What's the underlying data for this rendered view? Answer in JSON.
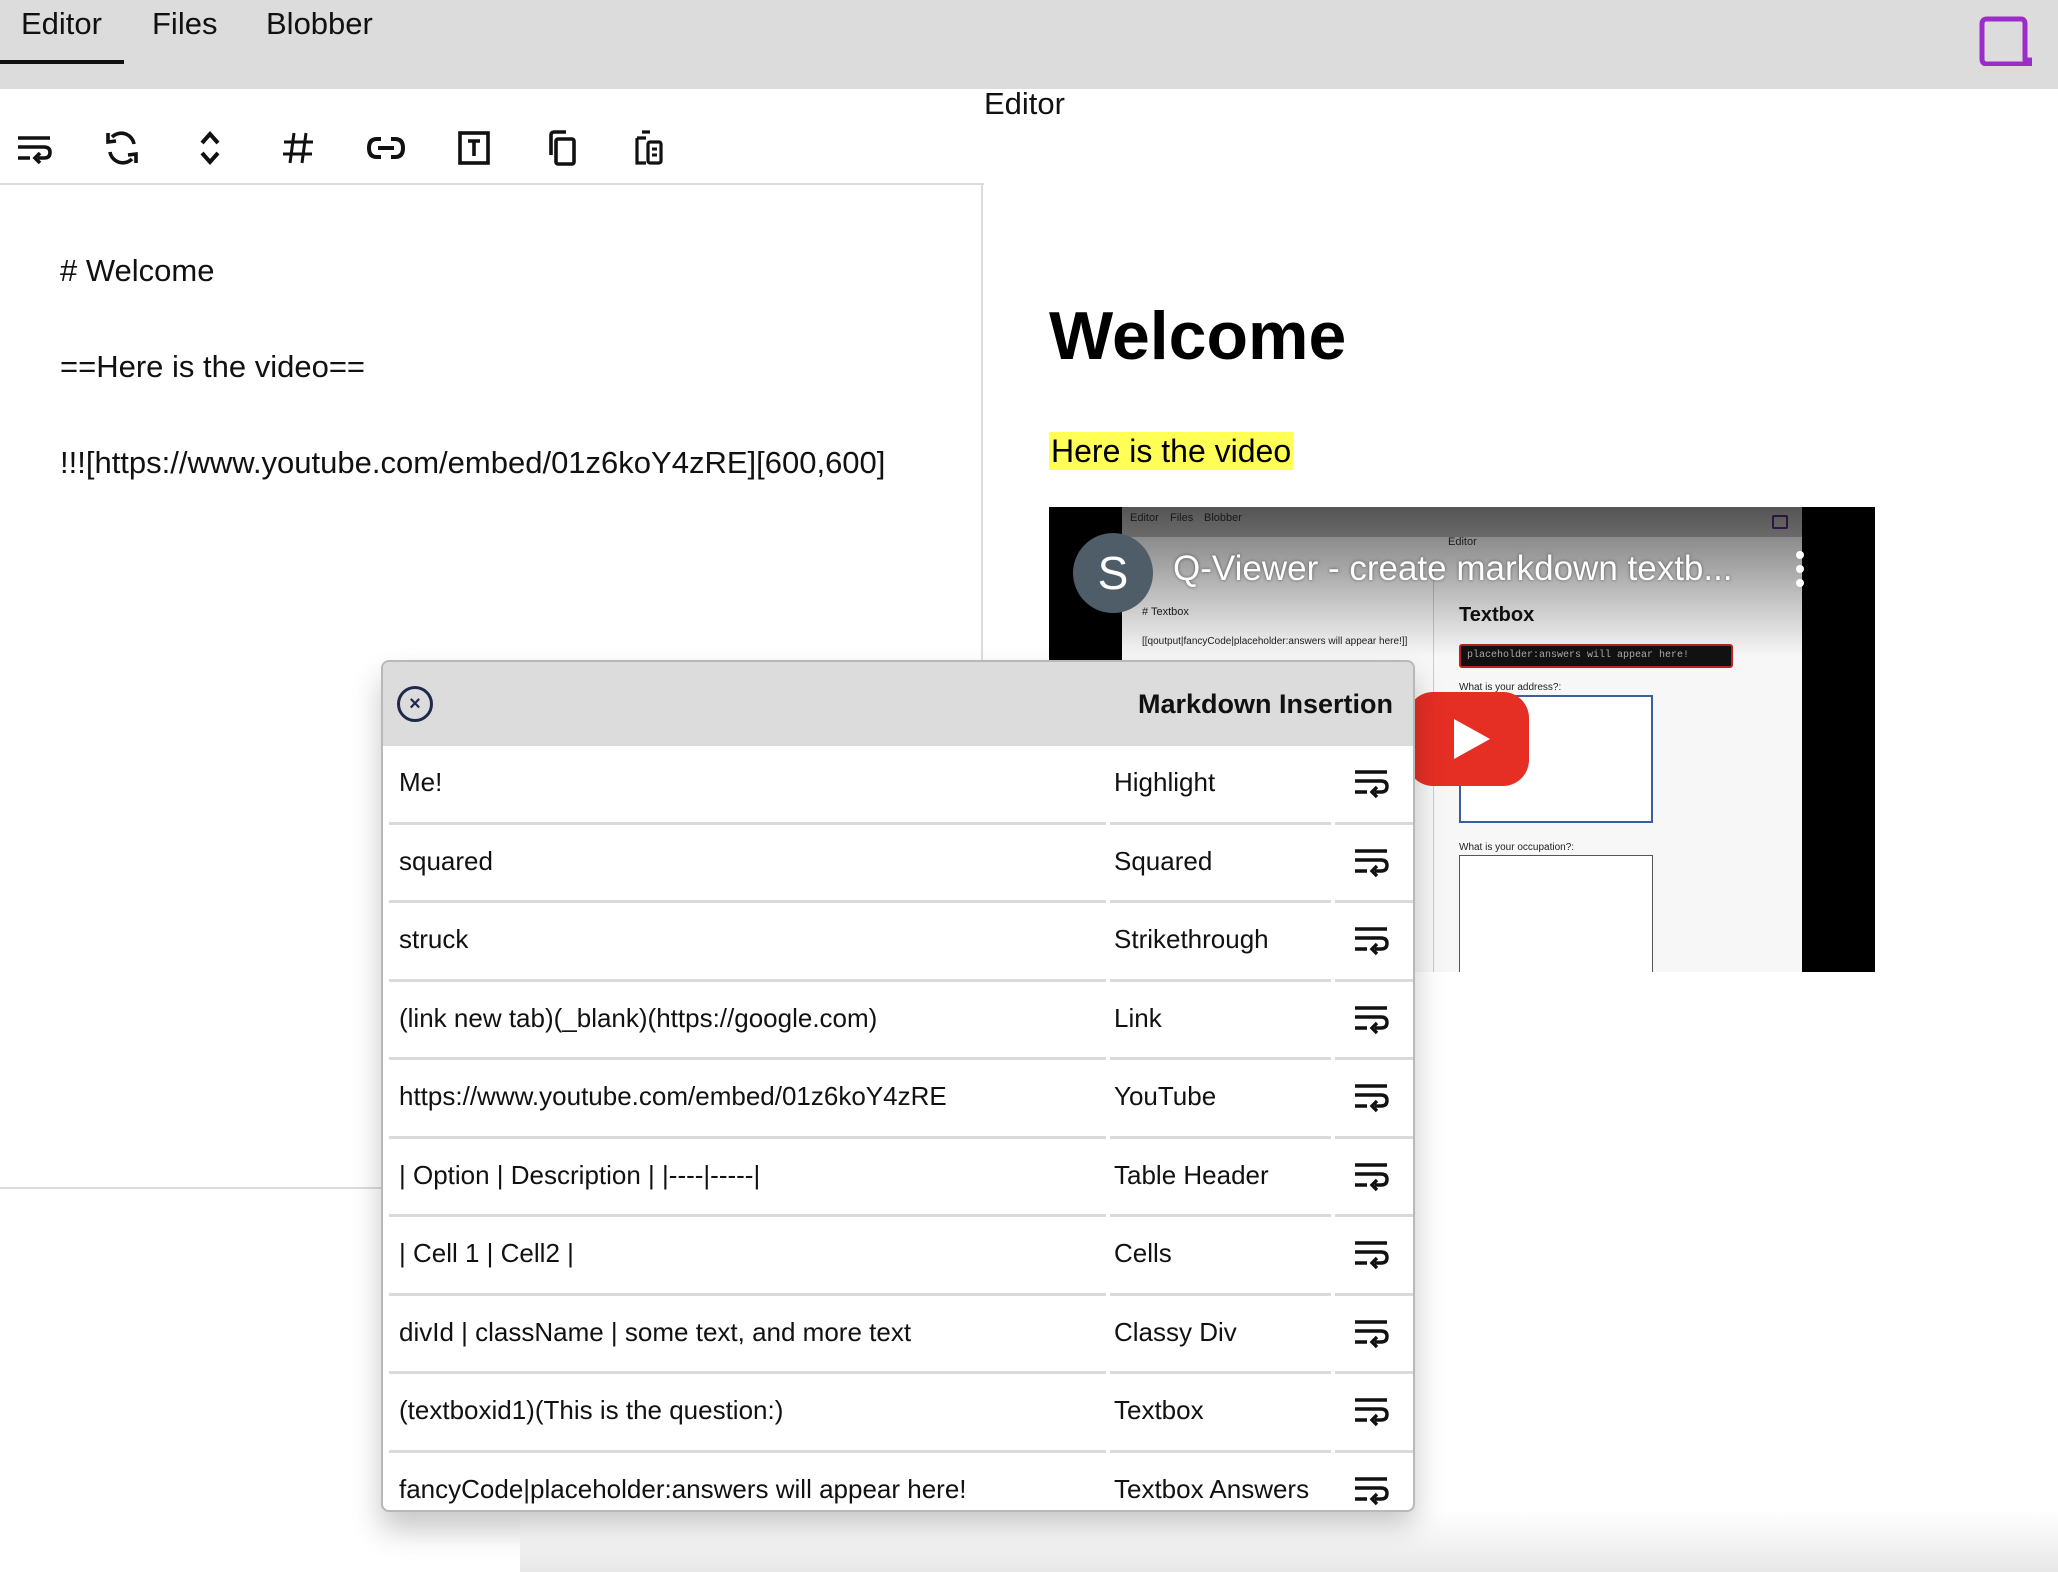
{
  "nav": {
    "tabs": [
      {
        "label": "Editor",
        "active": true
      },
      {
        "label": "Files",
        "active": false
      },
      {
        "label": "Blobber",
        "active": false
      }
    ],
    "logo_color": "#9b2cc8"
  },
  "page_title": "Editor",
  "toolbar": {
    "buttons": [
      {
        "icon": "wrap-text-icon"
      },
      {
        "icon": "refresh-icon"
      },
      {
        "icon": "expand-collapse-icon"
      },
      {
        "icon": "hash-icon"
      },
      {
        "icon": "link-icon"
      },
      {
        "icon": "text-box-icon"
      },
      {
        "icon": "copy-icon"
      },
      {
        "icon": "paste-icon"
      }
    ]
  },
  "editor": {
    "lines": [
      "# Welcome",
      "==Here is the video==",
      "!!![https://www.youtube.com/embed/01z6koY4zRE][600,600]"
    ]
  },
  "preview": {
    "heading": "Welcome",
    "highlight": "Here is the video",
    "highlight_color": "#ffff55",
    "video": {
      "channel_initial": "S",
      "title": "Q-Viewer - create markdown textb...",
      "inner": {
        "tabs": [
          "Editor",
          "Files",
          "Blobber"
        ],
        "page_title": "Editor",
        "editor_lines": [
          "# Textbox",
          "[[qoutput|fancyCode|placeholder:answers will appear here!]]"
        ],
        "heading": "Textbox",
        "answers_placeholder": "placeholder:answers will appear here!",
        "question1": "What is your address?:",
        "question2": "What is your occupation?:"
      }
    }
  },
  "dialog": {
    "title": "Markdown Insertion",
    "rows": [
      {
        "snippet": "Me!",
        "label": "Highlight"
      },
      {
        "snippet": "squared",
        "label": "Squared"
      },
      {
        "snippet": "struck",
        "label": "Strikethrough"
      },
      {
        "snippet": "(link new tab)(_blank)(https://google.com)",
        "label": "Link"
      },
      {
        "snippet": "https://www.youtube.com/embed/01z6koY4zRE",
        "label": "YouTube"
      },
      {
        "snippet": "| Option | Description | |----|-----|",
        "label": "Table Header"
      },
      {
        "snippet": "| Cell 1 | Cell2 |",
        "label": "Cells"
      },
      {
        "snippet": "divId | className | some text, and more text",
        "label": "Classy Div"
      },
      {
        "snippet": "(textboxid1)(This is the question:)",
        "label": "Textbox"
      },
      {
        "snippet": "fancyCode|placeholder:answers will appear here!",
        "label": "Textbox Answers"
      }
    ]
  }
}
